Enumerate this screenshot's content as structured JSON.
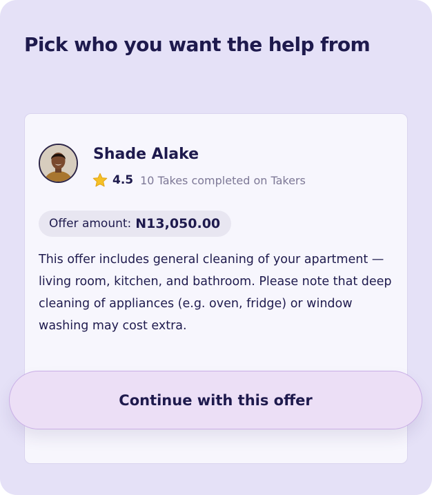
{
  "header": {
    "title": "Pick who you want the help from"
  },
  "offer": {
    "helper_name": "Shade Alake",
    "avatar_icon": "profile-photo",
    "rating_icon": "star-icon",
    "rating": "4.5",
    "takes_completed": "10 Takes completed on Takers",
    "amount_label": "Offer amount:",
    "amount_value": "N13,050.00",
    "description": "This offer includes general cleaning of your apartment — living room, kitchen, and bathroom. Please note that deep cleaning of appliances (e.g. oven, fridge) or window washing may cost extra."
  },
  "actions": {
    "continue_label": "Continue with this offer"
  },
  "colors": {
    "panel_background": "#e5e1f7",
    "card_background": "#f7f6fd",
    "text_primary": "#1e1a4d",
    "text_muted": "#7d7896",
    "button_background": "#ecdff6",
    "button_border": "#c9aee6",
    "star": "#f5c026"
  }
}
